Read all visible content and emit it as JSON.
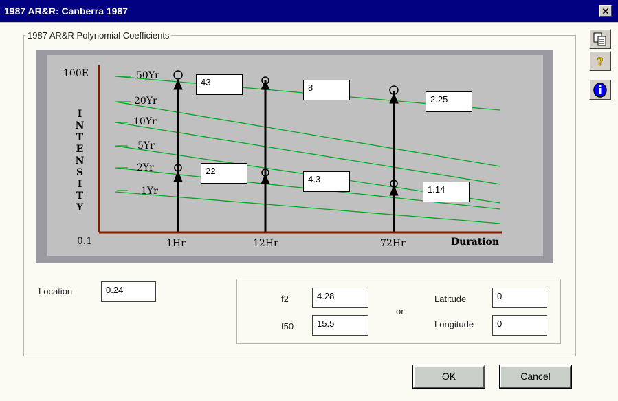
{
  "window": {
    "title": "1987 AR&R: Canberra 1987",
    "close_glyph": "✕"
  },
  "frame_label": "1987 AR&R Polynomial Coefficients",
  "chart": {
    "y_top": "100E",
    "y_bottom": "0.1",
    "y_title": [
      "I",
      "N",
      "T",
      "E",
      "N",
      "S",
      "I",
      "T",
      "Y"
    ],
    "return_periods": [
      "50Yr",
      "20Yr",
      "10Yr",
      "5Yr",
      "2Yr",
      "1Yr"
    ],
    "durations": [
      "1Hr",
      "12Hr",
      "72Hr"
    ],
    "x_title": "Duration",
    "values": {
      "v_1hr_50": "43",
      "v_12hr_50": "8",
      "v_72hr_50": "2.25",
      "v_1hr_2": "22",
      "v_12hr_2": "4.3",
      "v_72hr_2": "1.14"
    },
    "colors": {
      "axis": "#7a1e00",
      "curve": "#00aa22",
      "vline": "#000000",
      "bg": "#c0c0c0"
    }
  },
  "location": {
    "label": "Location",
    "value": "0.24"
  },
  "factors": {
    "f2_label": "f2",
    "f2_value": "4.28",
    "f50_label": "f50",
    "f50_value": "15.5",
    "or_label": "or",
    "lat_label": "Latitude",
    "lat_value": "0",
    "lon_label": "Longitude",
    "lon_value": "0"
  },
  "buttons": {
    "ok": "OK",
    "cancel": "Cancel"
  },
  "toolbar": {
    "copy_icon": "copy-icon",
    "help_icon": "help-icon",
    "info_icon": "info-icon"
  }
}
